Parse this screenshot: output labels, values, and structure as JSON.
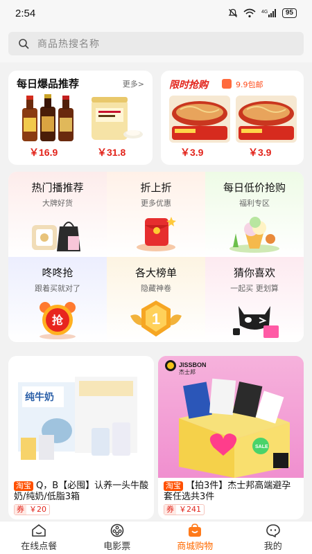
{
  "status_bar": {
    "time": "2:54",
    "battery": "95",
    "network": "4G"
  },
  "search": {
    "placeholder": "商品热搜名称"
  },
  "daily_hot": {
    "title": "每日爆品推荐",
    "more": "更多>",
    "items": [
      {
        "price": "￥16.9"
      },
      {
        "price": "￥31.8"
      }
    ]
  },
  "flash_sale": {
    "title": "限时抢购",
    "tag": "9.9包邮",
    "items": [
      {
        "price": "￥3.9"
      },
      {
        "price": "￥3.9"
      }
    ]
  },
  "grid": [
    {
      "title": "热门播推荐",
      "sub": "大牌好货"
    },
    {
      "title": "折上折",
      "sub": "更多优惠"
    },
    {
      "title": "每日低价抢购",
      "sub": "福利专区"
    },
    {
      "title": "咚咚抢",
      "sub": "跟着买就对了"
    },
    {
      "title": "各大榜单",
      "sub": "隐藏神卷"
    },
    {
      "title": "猜你喜欢",
      "sub": "一起买 更划算"
    }
  ],
  "products": [
    {
      "tag": "淘宝",
      "title": "Q，B【必囤】认养一头牛酸奶/纯奶/低脂3箱",
      "coupon_label": "券",
      "coupon_value": "￥20"
    },
    {
      "tag": "淘宝",
      "title": "【拍3件】杰士邦高端避孕套任选共3件",
      "coupon_label": "券",
      "coupon_value": "￥241"
    }
  ],
  "tabs": [
    {
      "label": "在线点餐",
      "icon": "home-icon"
    },
    {
      "label": "电影票",
      "icon": "film-reel-icon"
    },
    {
      "label": "商城购物",
      "icon": "shopping-bag-icon",
      "active": true
    },
    {
      "label": "我的",
      "icon": "chat-face-icon"
    }
  ],
  "colors": {
    "accent": "#ff6a00",
    "price": "#e2231a",
    "taobao": "#ff5000"
  }
}
